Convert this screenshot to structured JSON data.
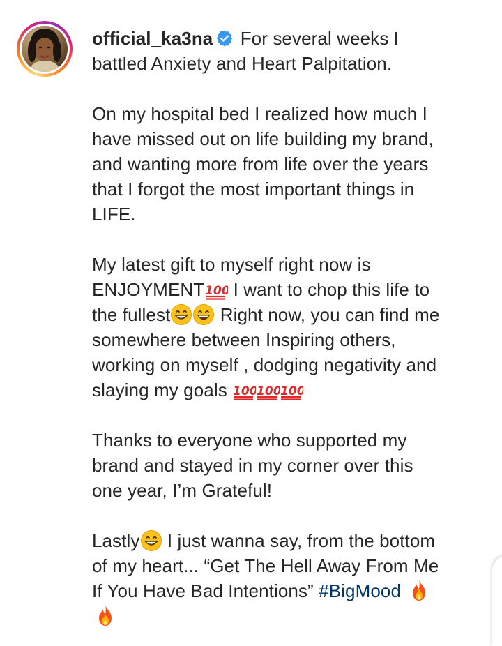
{
  "post": {
    "username": "official_ka3na",
    "verified": true,
    "avatar_icon": "profile-photo",
    "caption": {
      "p1": "For several weeks I battled Anxiety and Heart Palpitation.",
      "p2": "On my hospital bed I realized how much I have missed out on life building my brand, and wanting more from life over the years that I forgot the most important things in LIFE.",
      "p3_a": "My latest gift to myself right now is ENJOYMENT",
      "p3_b": " I want to chop this life to the fullest",
      "p3_c": " Right now, you can find me somewhere between Inspiring others, working on myself , dodging negativity and slaying my goals ",
      "p4": "Thanks to everyone who supported my brand and stayed in my corner over this one year, I’m Grateful!",
      "p5_a": "Lastly",
      "p5_b": " I just wanna say, from the bottom of my heart... “Get The Hell Away From Me If You Have Bad Intentions” ",
      "hashtag": "#BigMood"
    }
  },
  "colors": {
    "text": "#262626",
    "hashtag": "#00376b",
    "verified_badge": "#3897f0"
  }
}
